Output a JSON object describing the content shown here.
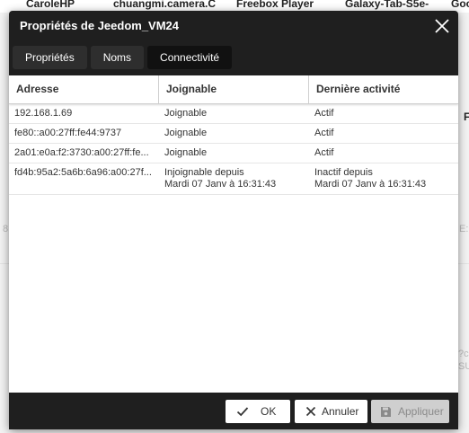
{
  "background": {
    "header_names": [
      "CaroleHP",
      "chuangmi.camera.C",
      "Freebox Player",
      "Galaxy-Tab-S5e-",
      "Goo"
    ],
    "fragments": [
      "F",
      "8",
      "E:",
      "?c!",
      "SU"
    ]
  },
  "dialog": {
    "title": "Propriétés de Jeedom_VM24",
    "tabs": [
      {
        "label": "Propriétés",
        "active": false
      },
      {
        "label": "Noms",
        "active": false
      },
      {
        "label": "Connectivité",
        "active": true
      }
    ],
    "table": {
      "columns": [
        "Adresse",
        "Joignable",
        "Dernière activité"
      ],
      "rows": [
        {
          "address": "192.168.1.69",
          "reachable": [
            "Joignable"
          ],
          "activity": [
            "Actif"
          ]
        },
        {
          "address": "fe80::a00:27ff:fe44:9737",
          "reachable": [
            "Joignable"
          ],
          "activity": [
            "Actif"
          ]
        },
        {
          "address": "2a01:e0a:f2:3730:a00:27ff:fe...",
          "reachable": [
            "Joignable"
          ],
          "activity": [
            "Actif"
          ]
        },
        {
          "address": "fd4b:95a2:5a6b:6a96:a00:27f...",
          "reachable": [
            "Injoignable depuis",
            "Mardi 07 Janv à 16:31:43"
          ],
          "activity": [
            "Inactif depuis",
            "Mardi 07 Janv à 16:31:43"
          ]
        }
      ]
    },
    "buttons": {
      "ok": "OK",
      "cancel": "Annuler",
      "apply": "Appliquer"
    }
  }
}
